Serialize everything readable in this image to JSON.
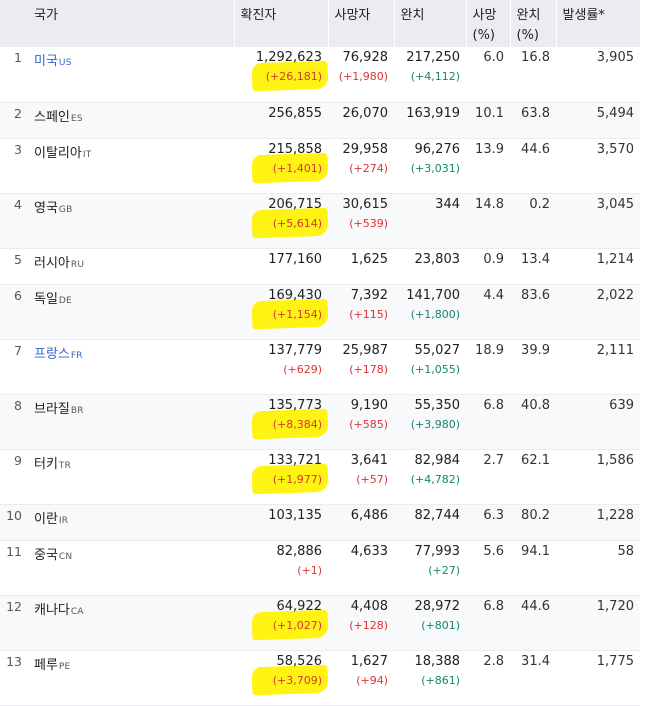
{
  "headers": {
    "country": "국가",
    "confirmed": "확진자",
    "deaths": "사망자",
    "recovered": "완치",
    "death_rate": "사망\n(%)",
    "recovery_rate": "완치\n(%)",
    "incidence": "발생률*"
  },
  "colors": {
    "header_bg": "#eaecf0",
    "link": "#3366cc",
    "increase": "#dd3333",
    "recovered_increase": "#14866d",
    "highlight": "#fff200"
  },
  "rows": [
    {
      "rank": "1",
      "country": "미국",
      "code": "US",
      "link": true,
      "confirmed": "1,292,623",
      "confirmed_delta": "(+26,181)",
      "highlighted": true,
      "deaths": "76,928",
      "deaths_delta": "(+1,980)",
      "recovered": "217,250",
      "recovered_delta": "(+4,112)",
      "death_rate": "6.0",
      "recovery_rate": "16.8",
      "incidence": "3,905"
    },
    {
      "rank": "2",
      "country": "스페인",
      "code": "ES",
      "link": false,
      "confirmed": "256,855",
      "confirmed_delta": "",
      "highlighted": false,
      "deaths": "26,070",
      "deaths_delta": "",
      "recovered": "163,919",
      "recovered_delta": "",
      "death_rate": "10.1",
      "recovery_rate": "63.8",
      "incidence": "5,494"
    },
    {
      "rank": "3",
      "country": "이탈리아",
      "code": "IT",
      "link": false,
      "confirmed": "215,858",
      "confirmed_delta": "(+1,401)",
      "highlighted": true,
      "deaths": "29,958",
      "deaths_delta": "(+274)",
      "recovered": "96,276",
      "recovered_delta": "(+3,031)",
      "death_rate": "13.9",
      "recovery_rate": "44.6",
      "incidence": "3,570"
    },
    {
      "rank": "4",
      "country": "영국",
      "code": "GB",
      "link": false,
      "confirmed": "206,715",
      "confirmed_delta": "(+5,614)",
      "highlighted": true,
      "deaths": "30,615",
      "deaths_delta": "(+539)",
      "recovered": "344",
      "recovered_delta": "",
      "death_rate": "14.8",
      "recovery_rate": "0.2",
      "incidence": "3,045"
    },
    {
      "rank": "5",
      "country": "러시아",
      "code": "RU",
      "link": false,
      "confirmed": "177,160",
      "confirmed_delta": "",
      "highlighted": false,
      "deaths": "1,625",
      "deaths_delta": "",
      "recovered": "23,803",
      "recovered_delta": "",
      "death_rate": "0.9",
      "recovery_rate": "13.4",
      "incidence": "1,214"
    },
    {
      "rank": "6",
      "country": "독일",
      "code": "DE",
      "link": false,
      "confirmed": "169,430",
      "confirmed_delta": "(+1,154)",
      "highlighted": true,
      "deaths": "7,392",
      "deaths_delta": "(+115)",
      "recovered": "141,700",
      "recovered_delta": "(+1,800)",
      "death_rate": "4.4",
      "recovery_rate": "83.6",
      "incidence": "2,022"
    },
    {
      "rank": "7",
      "country": "프랑스",
      "code": "FR",
      "link": true,
      "confirmed": "137,779",
      "confirmed_delta": "(+629)",
      "highlighted": false,
      "deaths": "25,987",
      "deaths_delta": "(+178)",
      "recovered": "55,027",
      "recovered_delta": "(+1,055)",
      "death_rate": "18.9",
      "recovery_rate": "39.9",
      "incidence": "2,111"
    },
    {
      "rank": "8",
      "country": "브라질",
      "code": "BR",
      "link": false,
      "confirmed": "135,773",
      "confirmed_delta": "(+8,384)",
      "highlighted": true,
      "deaths": "9,190",
      "deaths_delta": "(+585)",
      "recovered": "55,350",
      "recovered_delta": "(+3,980)",
      "death_rate": "6.8",
      "recovery_rate": "40.8",
      "incidence": "639"
    },
    {
      "rank": "9",
      "country": "터키",
      "code": "TR",
      "link": false,
      "confirmed": "133,721",
      "confirmed_delta": "(+1,977)",
      "highlighted": true,
      "deaths": "3,641",
      "deaths_delta": "(+57)",
      "recovered": "82,984",
      "recovered_delta": "(+4,782)",
      "death_rate": "2.7",
      "recovery_rate": "62.1",
      "incidence": "1,586"
    },
    {
      "rank": "10",
      "country": "이란",
      "code": "IR",
      "link": false,
      "confirmed": "103,135",
      "confirmed_delta": "",
      "highlighted": false,
      "deaths": "6,486",
      "deaths_delta": "",
      "recovered": "82,744",
      "recovered_delta": "",
      "death_rate": "6.3",
      "recovery_rate": "80.2",
      "incidence": "1,228"
    },
    {
      "rank": "11",
      "country": "중국",
      "code": "CN",
      "link": false,
      "confirmed": "82,886",
      "confirmed_delta": "(+1)",
      "highlighted": false,
      "deaths": "4,633",
      "deaths_delta": "",
      "recovered": "77,993",
      "recovered_delta": "(+27)",
      "death_rate": "5.6",
      "recovery_rate": "94.1",
      "incidence": "58"
    },
    {
      "rank": "12",
      "country": "캐나다",
      "code": "CA",
      "link": false,
      "confirmed": "64,922",
      "confirmed_delta": "(+1,027)",
      "highlighted": true,
      "deaths": "4,408",
      "deaths_delta": "(+128)",
      "recovered": "28,972",
      "recovered_delta": "(+801)",
      "death_rate": "6.8",
      "recovery_rate": "44.6",
      "incidence": "1,720"
    },
    {
      "rank": "13",
      "country": "페루",
      "code": "PE",
      "link": false,
      "confirmed": "58,526",
      "confirmed_delta": "(+3,709)",
      "highlighted": true,
      "deaths": "1,627",
      "deaths_delta": "(+94)",
      "recovered": "18,388",
      "recovered_delta": "(+861)",
      "death_rate": "2.8",
      "recovery_rate": "31.4",
      "incidence": "1,775"
    }
  ]
}
